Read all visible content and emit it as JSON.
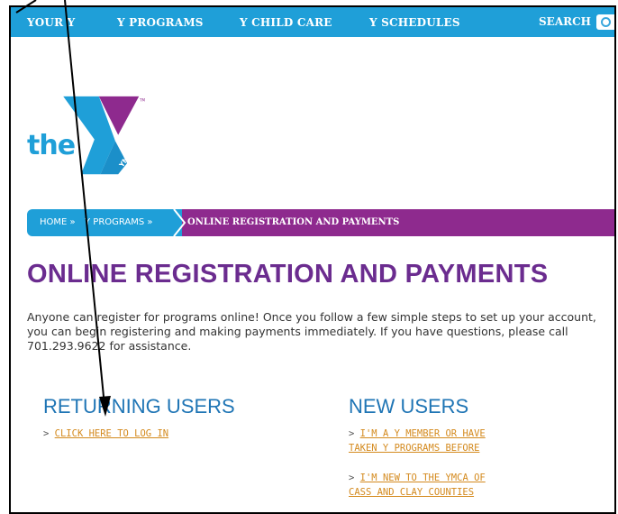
{
  "nav": {
    "items": [
      "YOUR Y",
      "Y PROGRAMS",
      "Y CHILD CARE",
      "Y SCHEDULES"
    ],
    "search_label": "SEARCH"
  },
  "logo": {
    "the_text": "the",
    "ymca_text": "YMCA",
    "tm_text": "TM",
    "colors": {
      "blue": "#1f9fd8",
      "purple": "#8e2a8e"
    }
  },
  "breadcrumb": {
    "home": "HOME »",
    "programs": "Y PROGRAMS »",
    "current": "ONLINE REGISTRATION AND PAYMENTS"
  },
  "page": {
    "title": "ONLINE REGISTRATION AND PAYMENTS",
    "intro": "Anyone can register for programs online! Once you follow a few simple steps to set up your account, you can begin registering and making payments immediately. If you have questions, please call 701.293.9622 for assistance."
  },
  "returning": {
    "heading": "RETURNING USERS",
    "link_prefix": "> ",
    "link": "CLICK HERE TO LOG IN"
  },
  "new_users": {
    "heading": "NEW USERS",
    "link1_prefix": "> ",
    "link1_line1": "I'M A Y MEMBER OR HAVE",
    "link1_line2": "TAKEN Y PROGRAMS BEFORE",
    "link2_prefix": "> ",
    "link2_line1": "I'M NEW TO THE YMCA OF",
    "link2_line2": "CASS AND CLAY COUNTIES"
  },
  "annotation": {
    "arrow_color": "#000000"
  }
}
